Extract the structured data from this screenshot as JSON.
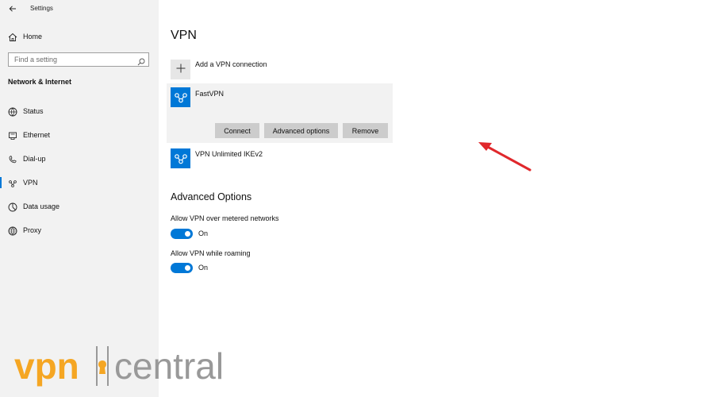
{
  "window": {
    "title": "Settings"
  },
  "sidebar": {
    "home_label": "Home",
    "search_placeholder": "Find a setting",
    "section_heading": "Network & Internet",
    "items": [
      {
        "label": "Status",
        "icon": "globe-status-icon"
      },
      {
        "label": "Ethernet",
        "icon": "ethernet-icon"
      },
      {
        "label": "Dial-up",
        "icon": "dialup-icon"
      },
      {
        "label": "VPN",
        "icon": "vpn-icon",
        "selected": true
      },
      {
        "label": "Data usage",
        "icon": "data-usage-icon"
      },
      {
        "label": "Proxy",
        "icon": "globe-icon"
      }
    ]
  },
  "main": {
    "title": "VPN",
    "add_connection_label": "Add a VPN connection",
    "connections": [
      {
        "name": "FastVPN",
        "expanded": true
      },
      {
        "name": "VPN Unlimited IKEv2",
        "expanded": false
      }
    ],
    "actions": {
      "connect": "Connect",
      "advanced_options": "Advanced options",
      "remove": "Remove"
    },
    "advanced": {
      "heading": "Advanced Options",
      "settings": [
        {
          "label": "Allow VPN over metered networks",
          "state": "On"
        },
        {
          "label": "Allow VPN while roaming",
          "state": "On"
        }
      ]
    }
  },
  "watermark": {
    "part1": "vpn",
    "part2": "central"
  },
  "colors": {
    "accent": "#0078d7",
    "sidebar_bg": "#f2f2f2",
    "button_bg": "#cccccc",
    "arrow": "#e0282c",
    "watermark_orange": "#f5a623",
    "watermark_gray": "#999999"
  }
}
